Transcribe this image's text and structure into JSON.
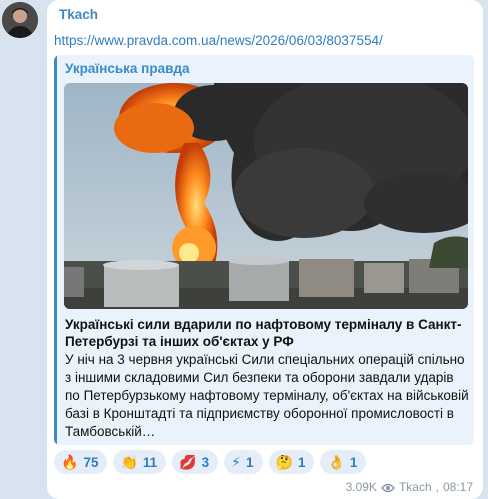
{
  "message": {
    "sender": "Tkach",
    "link": "https://www.pravda.com.ua/news/2026/06/03/8037554/",
    "preview": {
      "site_name": "Українська правда",
      "title": "Українські сили вдарили по нафтовому терміналу в Санкт-Петербурзі та інших об'єктах у РФ",
      "description": "У ніч на 3 червня українські Сили спеціальних операцій спільно з іншими складовими Сил безпеки та оборони завдали ударів по Петербурзькому нафтовому терміналу, об'єктах на військовій базі в Кронштадті та підприємству оборонної промисловості в Тамбовській…"
    },
    "reactions": [
      {
        "emoji": "🔥",
        "icon": "fire-icon",
        "count": "75"
      },
      {
        "emoji": "👏",
        "icon": "clapping-hands-icon",
        "count": "11"
      },
      {
        "emoji": "💋",
        "icon": "kiss-mark-icon",
        "count": "3"
      },
      {
        "emoji": "⚡",
        "icon": "lightning-icon",
        "count": "1"
      },
      {
        "emoji": "🤔",
        "icon": "thinking-face-icon",
        "count": "1"
      },
      {
        "emoji": "👌",
        "icon": "ok-hand-icon",
        "count": "1"
      }
    ],
    "views": "3.09K",
    "author": "Tkach",
    "time": "08:17",
    "colors": {
      "accent": "#3a8ac9",
      "background": "#d7e4f0",
      "preview_bg": "#eaf3fb"
    }
  }
}
